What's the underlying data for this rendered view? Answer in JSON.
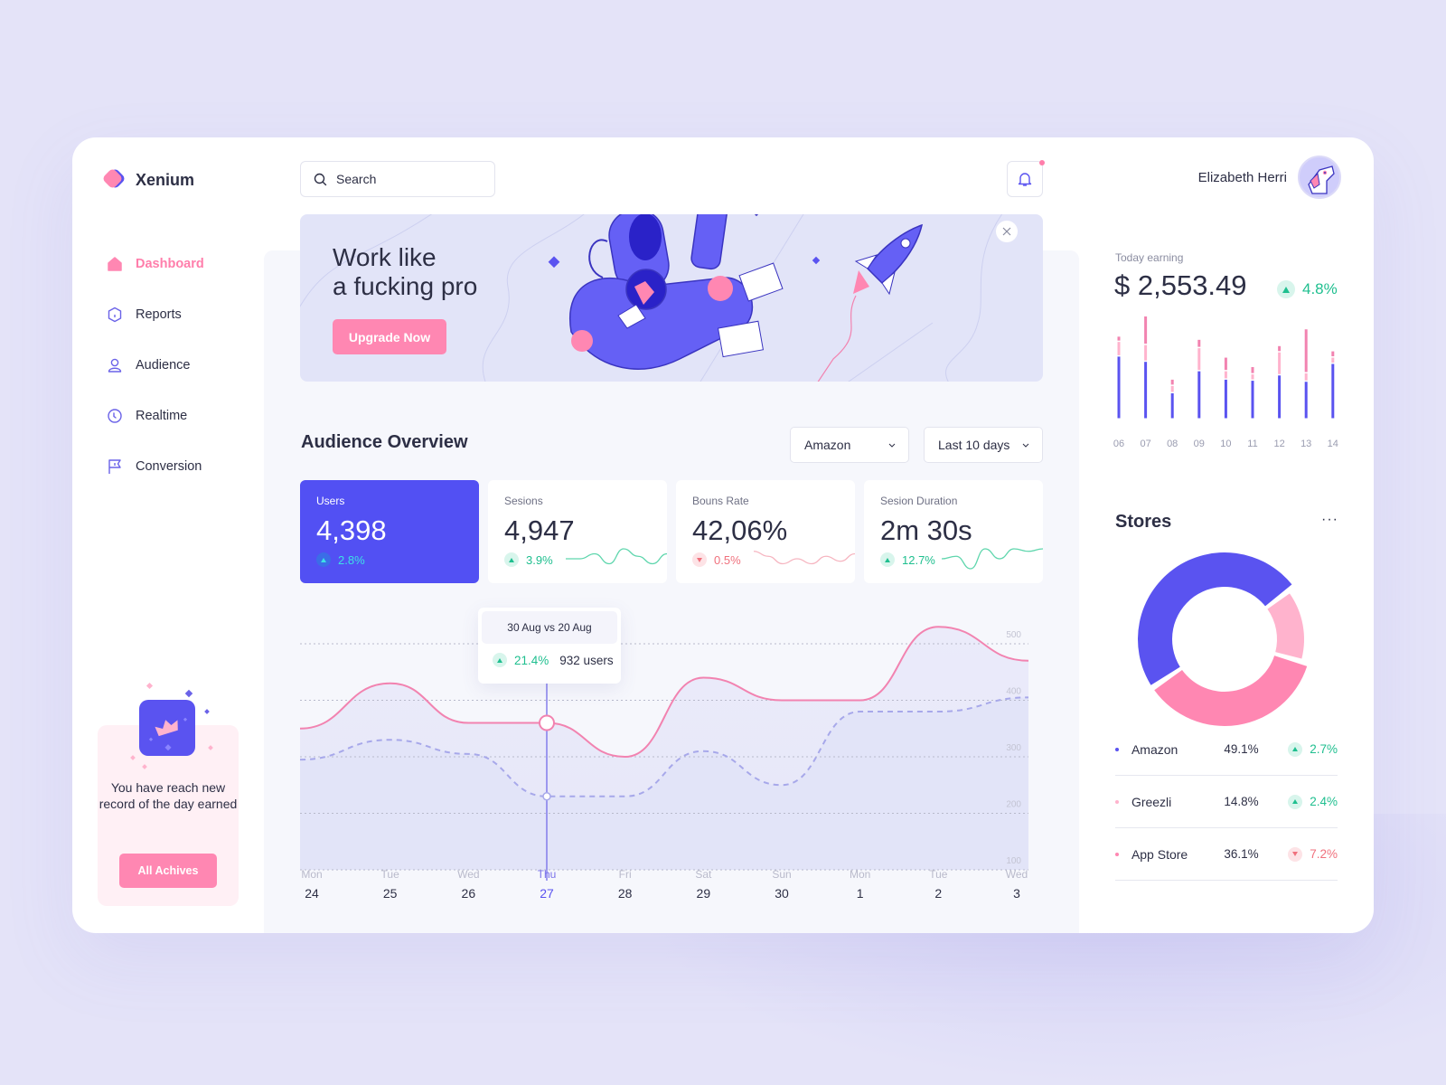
{
  "app": {
    "name": "Xenium"
  },
  "search": {
    "placeholder": "Search",
    "value": ""
  },
  "user": {
    "name": "Elizabeth Herri",
    "has_notification": true
  },
  "nav": [
    {
      "label": "Dashboard",
      "icon": "home-icon",
      "active": true
    },
    {
      "label": "Reports",
      "icon": "hexagon-icon",
      "active": false
    },
    {
      "label": "Audience",
      "icon": "user-icon",
      "active": false
    },
    {
      "label": "Realtime",
      "icon": "clock-icon",
      "active": false
    },
    {
      "label": "Conversion",
      "icon": "flag-icon",
      "active": false
    }
  ],
  "achievement": {
    "text": "You have reach new record of the day earned",
    "button": "All Achives",
    "icon": "crown-icon"
  },
  "banner": {
    "title_line1": "Work like",
    "title_line2": "a fucking pro",
    "button": "Upgrade Now"
  },
  "audience": {
    "title": "Audience Overview",
    "store_filter": "Amazon",
    "range_filter": "Last 10 days",
    "cards": [
      {
        "label": "Users",
        "value": "4,398",
        "delta": "2.8%",
        "direction": "up",
        "active": true
      },
      {
        "label": "Sesions",
        "value": "4,947",
        "delta": "3.9%",
        "direction": "up",
        "active": false
      },
      {
        "label": "Bouns Rate",
        "value": "42,06%",
        "delta": "0.5%",
        "direction": "down",
        "active": false
      },
      {
        "label": "Sesion Duration",
        "value": "2m 30s",
        "delta": "12.7%",
        "direction": "up",
        "active": false
      }
    ],
    "tooltip": {
      "title": "30 Aug vs 20 Aug",
      "delta": "21.4%",
      "users": "932 users"
    }
  },
  "earning": {
    "label": "Today earning",
    "value": "$ 2,553.49",
    "delta": "4.8%",
    "direction": "up"
  },
  "stores": {
    "title": "Stores",
    "more": "···",
    "rows": [
      {
        "name": "Amazon",
        "share": "49.1%",
        "delta": "2.7%",
        "direction": "up",
        "color": "#5a53f0"
      },
      {
        "name": "Greezli",
        "share": "14.8%",
        "delta": "2.4%",
        "direction": "up",
        "color": "#ffb3cd"
      },
      {
        "name": "App Store",
        "share": "36.1%",
        "delta": "7.2%",
        "direction": "down",
        "color": "#ff87b2"
      }
    ]
  },
  "colors": {
    "primary": "#5250f3",
    "pink": "#ff87b2",
    "light_pink": "#ffb3cd",
    "green": "#1fbf8f",
    "red": "#f0717d",
    "text": "#2d2f45"
  },
  "chart_data": [
    {
      "id": "audience-line",
      "type": "line",
      "title": "",
      "xlabel": "",
      "ylabel": "",
      "ylim": [
        100,
        500
      ],
      "y_ticks": [
        "500",
        "400",
        "300",
        "200",
        "100"
      ],
      "grid": true,
      "x_days": [
        "Mon",
        "Tue",
        "Wed",
        "Thu",
        "Fri",
        "Sat",
        "Sun",
        "Mon",
        "Tue",
        "Wed"
      ],
      "x_dates": [
        "24",
        "25",
        "26",
        "27",
        "28",
        "29",
        "30",
        "1",
        "2",
        "3"
      ],
      "highlight_index": 3,
      "series": [
        {
          "name": "current",
          "style": "solid",
          "color": "#f283b0",
          "values": [
            350,
            430,
            360,
            360,
            300,
            440,
            400,
            400,
            530,
            470
          ]
        },
        {
          "name": "previous",
          "style": "dashed",
          "color": "#a7a8ea",
          "values": [
            295,
            330,
            305,
            230,
            230,
            310,
            250,
            380,
            380,
            405
          ]
        }
      ]
    },
    {
      "id": "earning-bars",
      "type": "bar",
      "categories": [
        "06",
        "07",
        "08",
        "09",
        "10",
        "11",
        "12",
        "13",
        "14"
      ],
      "series": [
        {
          "name": "base",
          "color": "#5a53f0",
          "values": [
            60,
            55,
            25,
            46,
            38,
            37,
            42,
            36,
            53
          ]
        },
        {
          "name": "mid",
          "color": "#ffb3cd",
          "values": [
            14,
            16,
            7,
            22,
            8,
            6,
            22,
            8,
            6
          ]
        },
        {
          "name": "top",
          "color": "#f283b0",
          "values": [
            5,
            32,
            6,
            8,
            13,
            7,
            6,
            42,
            6
          ]
        }
      ]
    },
    {
      "id": "stores-donut",
      "type": "pie",
      "labels": [
        "Amazon",
        "Greezli",
        "App Store"
      ],
      "values": [
        49.1,
        14.8,
        36.1
      ],
      "colors": [
        "#5a53f0",
        "#ffb3cd",
        "#ff87b2"
      ]
    },
    {
      "id": "spark-sessions",
      "type": "line",
      "color": "#5fd6ad",
      "values": [
        4,
        4,
        6,
        2,
        8,
        5,
        2,
        6
      ]
    },
    {
      "id": "spark-bounce",
      "type": "line",
      "color": "#f6b5c0",
      "values": [
        7,
        5,
        2,
        4,
        2,
        5,
        3,
        6
      ]
    },
    {
      "id": "spark-duration",
      "type": "line",
      "color": "#5fd6ad",
      "values": [
        4,
        5,
        0,
        8,
        4,
        8,
        7,
        8
      ]
    }
  ]
}
